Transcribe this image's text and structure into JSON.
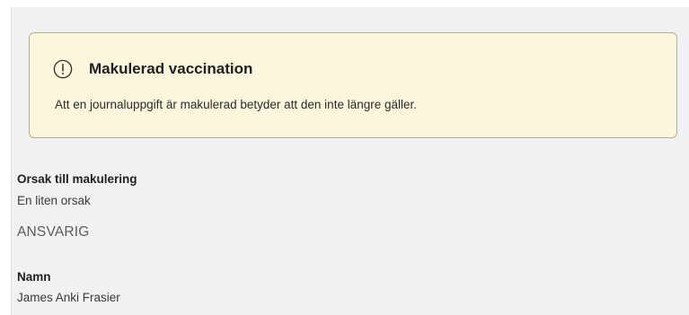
{
  "alert": {
    "icon": "exclamation-circle-icon",
    "title": "Makulerad vaccination",
    "text": "Att en journaluppgift är makulerad betyder att den inte längre gäller."
  },
  "reason": {
    "label": "Orsak till makulering",
    "value": "En liten orsak"
  },
  "responsible": {
    "heading": "ANSVARIG",
    "name_label": "Namn",
    "name_value": "James Anki Frasier"
  }
}
